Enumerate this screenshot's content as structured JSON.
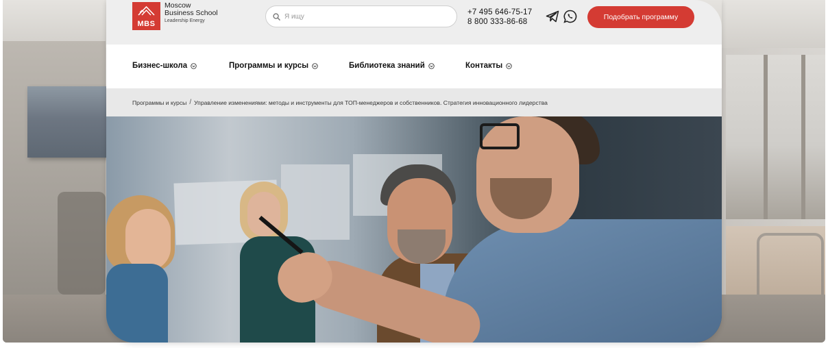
{
  "header": {
    "logo": {
      "badge": "MBS",
      "line1": "Moscow",
      "line2": "Business School",
      "tagline": "Leadership Energy"
    },
    "search": {
      "placeholder": "Я ищу",
      "value": ""
    },
    "phones": [
      "+7 495 646-75-17",
      "8 800 333-86-68"
    ],
    "social": [
      "telegram-icon",
      "whatsapp-icon"
    ],
    "cta_label": "Подобрать программу"
  },
  "nav": {
    "items": [
      {
        "label": "Бизнес-школа"
      },
      {
        "label": "Программы и курсы"
      },
      {
        "label": "Библиотека знаний"
      },
      {
        "label": "Контакты"
      }
    ]
  },
  "breadcrumb": {
    "parent": "Программы и курсы",
    "separator": "/",
    "current": "Управление изменениями: методы и инструменты для ТОП-менеджеров и собственников. Стратегия инновационного лидерства"
  },
  "colors": {
    "brand_red": "#d43b33",
    "topbar_bg": "#eeeeee",
    "breadcrumb_bg": "#e8e8e8"
  }
}
